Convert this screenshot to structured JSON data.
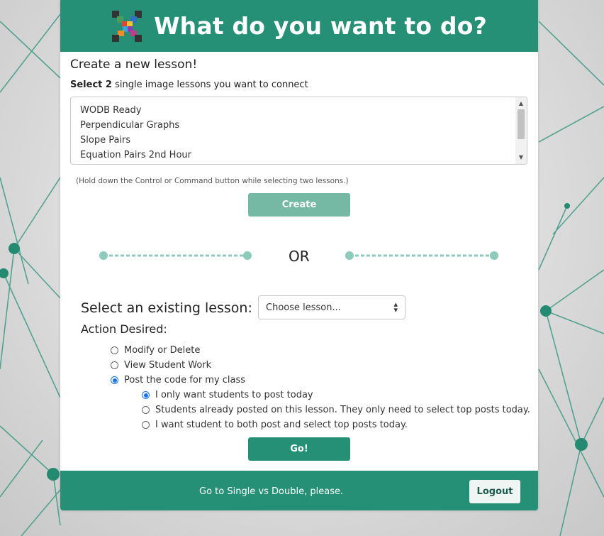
{
  "header": {
    "title": "What do you want to do?",
    "logo_icon": "puzzle-x-logo-icon"
  },
  "create_section": {
    "title": "Create a new lesson!",
    "instruction_bold": "Select 2",
    "instruction_rest": " single image lessons you want to connect",
    "lessons": [
      "WODB Ready",
      "Perpendicular Graphs",
      "Slope Pairs",
      "Equation Pairs 2nd Hour"
    ],
    "hint": "(Hold down the Control or Command button while selecting two lessons.)",
    "create_label": "Create"
  },
  "divider": {
    "text": "OR"
  },
  "existing_section": {
    "label": "Select an existing lesson:",
    "dropdown_value": "Choose lesson...",
    "action_label": "Action Desired:",
    "actions": [
      {
        "label": "Modify or Delete",
        "checked": false
      },
      {
        "label": "View Student Work",
        "checked": false
      },
      {
        "label": "Post the code for my class",
        "checked": true
      }
    ],
    "post_options": [
      {
        "label": "I only want students to post today",
        "checked": true
      },
      {
        "label": "Students already posted on this lesson. They only need to select top posts today.",
        "checked": false
      },
      {
        "label": "I want student to both post and select top posts today.",
        "checked": false
      }
    ],
    "go_label": "Go!"
  },
  "footer": {
    "text": "Go to Single vs Double, please.",
    "logout_label": "Logout"
  },
  "colors": {
    "brand": "#259075",
    "brand_light": "#75b9a5",
    "radio_checked": "#1a73e8"
  }
}
